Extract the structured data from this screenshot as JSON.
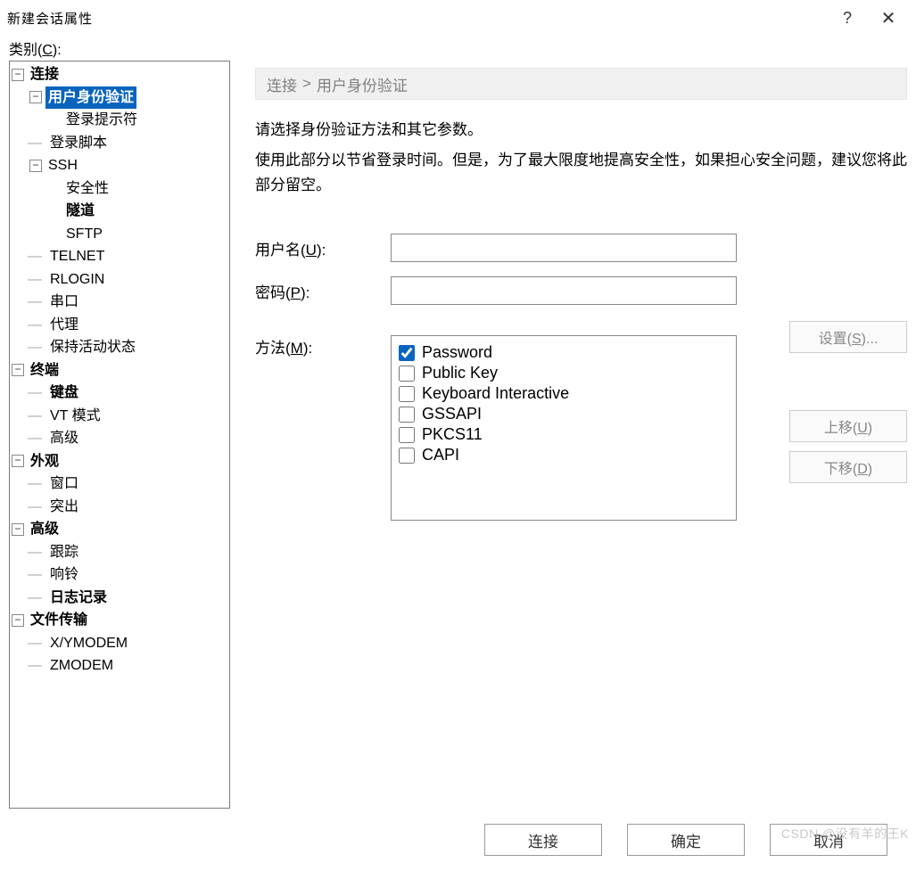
{
  "titlebar": {
    "title": "新建会话属性",
    "help": "?",
    "close": "✕"
  },
  "category_label_pre": "类别(",
  "category_label_u": "C",
  "category_label_post": "):",
  "tree": {
    "connection": {
      "label": "连接"
    },
    "user_auth": {
      "label": "用户身份验证"
    },
    "login_prompt": {
      "label": "登录提示符"
    },
    "login_script": {
      "label": "登录脚本"
    },
    "ssh": {
      "label": "SSH"
    },
    "security": {
      "label": "安全性"
    },
    "tunnel": {
      "label": "隧道"
    },
    "sftp": {
      "label": "SFTP"
    },
    "telnet": {
      "label": "TELNET"
    },
    "rlogin": {
      "label": "RLOGIN"
    },
    "serial": {
      "label": "串口"
    },
    "proxy": {
      "label": "代理"
    },
    "keepalive": {
      "label": "保持活动状态"
    },
    "terminal": {
      "label": "终端"
    },
    "keyboard": {
      "label": "键盘"
    },
    "vtmode": {
      "label": "VT 模式"
    },
    "advanced_t": {
      "label": "高级"
    },
    "appearance": {
      "label": "外观"
    },
    "window": {
      "label": "窗口"
    },
    "highlight": {
      "label": "突出"
    },
    "advanced": {
      "label": "高级"
    },
    "trace": {
      "label": "跟踪"
    },
    "bell": {
      "label": "响铃"
    },
    "logging": {
      "label": "日志记录"
    },
    "filetransfer": {
      "label": "文件传输"
    },
    "xymodem": {
      "label": "X/YMODEM"
    },
    "zmodem": {
      "label": "ZMODEM"
    }
  },
  "breadcrumb": {
    "root": "连接",
    "current": "用户身份验证",
    "sep": ">"
  },
  "description": {
    "line1": "请选择身份验证方法和其它参数。",
    "line2": "使用此部分以节省登录时间。但是，为了最大限度地提高安全性，如果担心安全问题，建议您将此部分留空。"
  },
  "fields": {
    "username_label_pre": "用户名(",
    "username_label_u": "U",
    "username_label_post": "):",
    "username_value": "",
    "password_label_pre": "密码(",
    "password_label_u": "P",
    "password_label_post": "):",
    "password_value": "",
    "method_label_pre": "方法(",
    "method_label_u": "M",
    "method_label_post": "):"
  },
  "methods": [
    {
      "label": "Password",
      "checked": true
    },
    {
      "label": "Public Key",
      "checked": false
    },
    {
      "label": "Keyboard Interactive",
      "checked": false
    },
    {
      "label": "GSSAPI",
      "checked": false
    },
    {
      "label": "PKCS11",
      "checked": false
    },
    {
      "label": "CAPI",
      "checked": false
    }
  ],
  "sidebuttons": {
    "settings_pre": "设置(",
    "settings_u": "S",
    "settings_post": ")...",
    "up_pre": "上移(",
    "up_u": "U",
    "up_post": ")",
    "down_pre": "下移(",
    "down_u": "D",
    "down_post": ")"
  },
  "footer": {
    "connect": "连接",
    "ok": "确定",
    "cancel": "取消"
  },
  "watermark": "CSDN @没有羊的王K"
}
